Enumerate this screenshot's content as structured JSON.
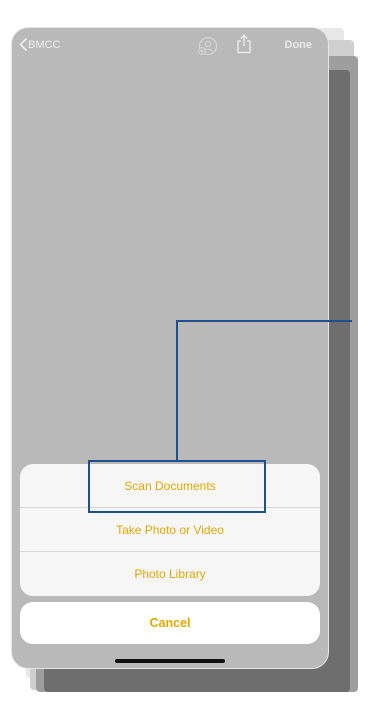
{
  "nav": {
    "back_label": "BMCC",
    "done_label": "Done",
    "collab_icon": "person-add-icon",
    "share_icon": "share-icon"
  },
  "action_sheet": {
    "items": [
      {
        "label": "Scan Documents"
      },
      {
        "label": "Take Photo or Video"
      },
      {
        "label": "Photo Library"
      }
    ],
    "cancel_label": "Cancel"
  },
  "colors": {
    "accent": "#e0a800",
    "screen_dim": "#b9b9b9",
    "annotation": "#1f4f8f"
  }
}
